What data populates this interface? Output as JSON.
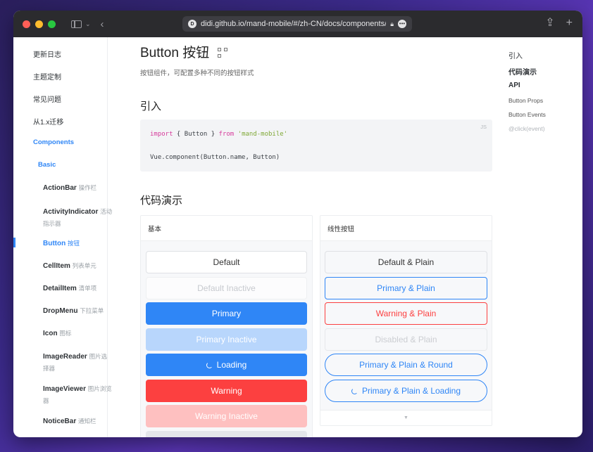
{
  "browser": {
    "url": "didi.github.io/mand-mobile/#/zh-CN/docs/components/basic/",
    "site_icon_text": "D"
  },
  "nav": {
    "items": [
      {
        "label": "更新日志"
      },
      {
        "label": "主题定制"
      },
      {
        "label": "常见问题"
      },
      {
        "label": "从1.x迁移"
      }
    ],
    "section": "Components",
    "group": "Basic",
    "components": [
      {
        "en": "ActionBar",
        "zh": "操作栏"
      },
      {
        "en": "ActivityIndicator",
        "zh": "活动",
        "zh2": "指示器"
      },
      {
        "en": "Button",
        "zh": "按钮"
      },
      {
        "en": "CellItem",
        "zh": "列表单元"
      },
      {
        "en": "DetailItem",
        "zh": "清单项"
      },
      {
        "en": "DropMenu",
        "zh": "下拉菜单"
      },
      {
        "en": "Icon",
        "zh": "图标"
      },
      {
        "en": "ImageReader",
        "zh": "图片选",
        "zh2": "择器"
      },
      {
        "en": "ImageViewer",
        "zh": "图片浏览",
        "zh2": "器"
      },
      {
        "en": "NoticeBar",
        "zh": "通知栏"
      }
    ]
  },
  "main": {
    "title": "Button 按钮",
    "description": "按钮组件，可配置多种不同的按钮样式",
    "h_import": "引入",
    "code": {
      "lang": "JS",
      "kw_import": "import",
      "brace_open": " { Button } ",
      "kw_from": "from",
      "module": "'mand-mobile'",
      "line2": "Vue.component(Button.name, Button)"
    },
    "h_demo": "代码演示",
    "demo_basic": {
      "title": "基本",
      "buttons": [
        "Default",
        "Default Inactive",
        "Primary",
        "Primary Inactive",
        "Loading",
        "Warning",
        "Warning Inactive"
      ]
    },
    "demo_plain": {
      "title": "线性按钮",
      "buttons": [
        "Default & Plain",
        "Primary & Plain",
        "Warning & Plain",
        "Disabled & Plain",
        "Primary & Plain & Round",
        "Primary & Plain & Loading"
      ]
    }
  },
  "toc": {
    "items": [
      "引入",
      "代码演示",
      "API",
      "Button Props",
      "Button Events",
      "@click(event)"
    ]
  },
  "colors": {
    "accent": "#2f86f6",
    "warning": "#fc4040"
  }
}
